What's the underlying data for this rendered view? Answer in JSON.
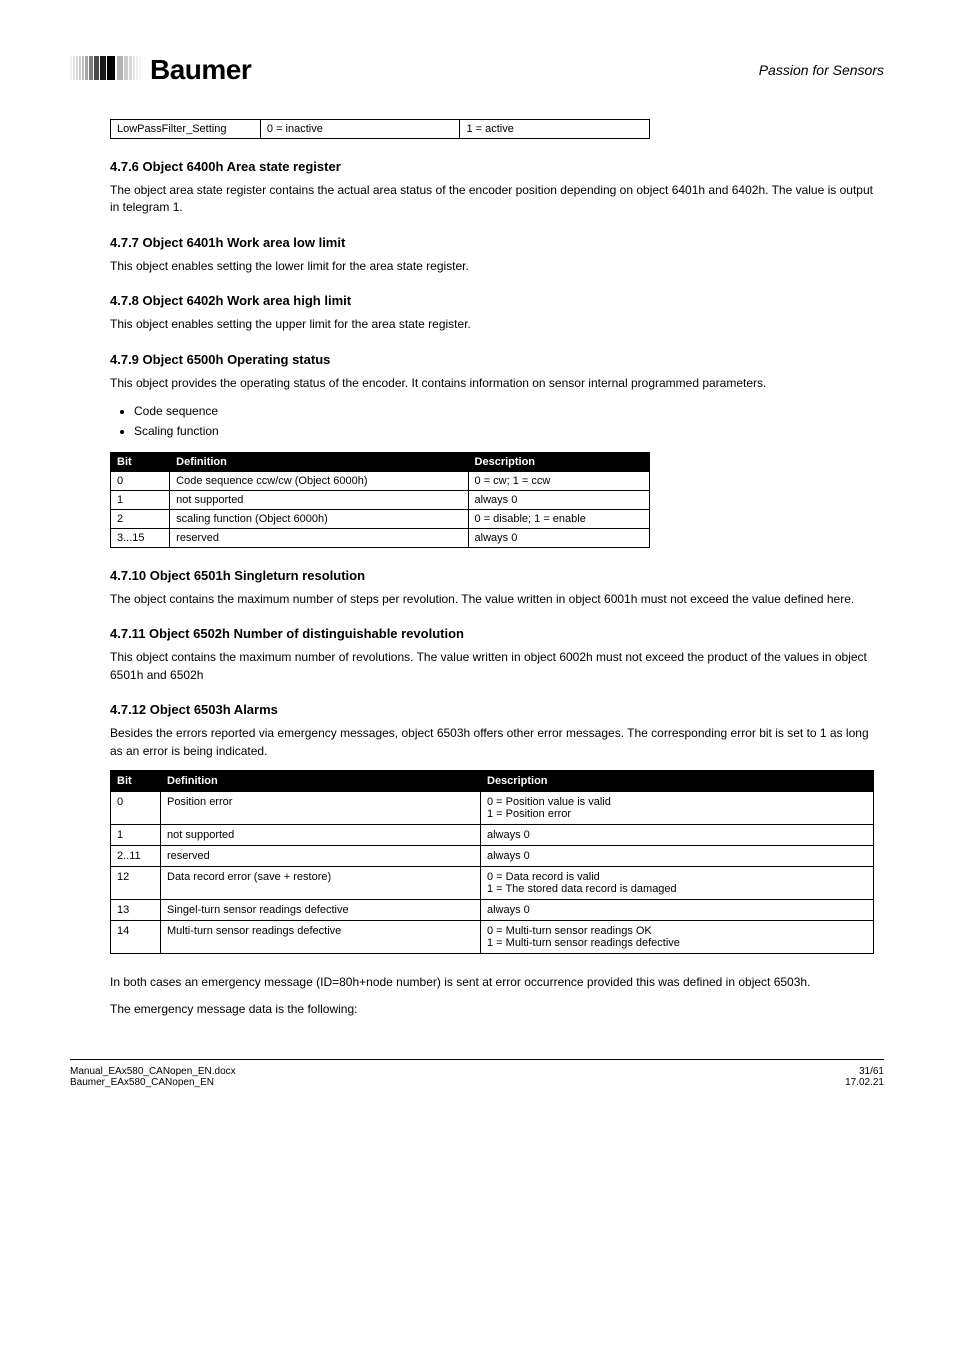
{
  "header": {
    "logo_text": "Baumer",
    "tagline": "Passion for Sensors"
  },
  "table1": {
    "rows": [
      {
        "c1": "LowPassFilter_Setting",
        "c2": "0 = inactive",
        "c3": "1 = active"
      }
    ]
  },
  "section_4_7_6": {
    "title": "4.7.6 Object 6400h Area state register",
    "text": "The object area state register contains the actual area status of the encoder position depending on object 6401h and 6402h. The value is output in telegram 1."
  },
  "section_4_7_7": {
    "title": "4.7.7 Object 6401h Work area low limit",
    "text": "This object enables setting the lower limit for the area state register."
  },
  "section_4_7_8": {
    "title": "4.7.8 Object 6402h Work area high limit",
    "text": "This object enables setting the upper limit for the area state register."
  },
  "section_4_7_9": {
    "title": "4.7.9 Object 6500h Operating status",
    "para1": "This object provides the operating status of the encoder. It contains information on sensor internal programmed parameters.",
    "table": {
      "headers": [
        "Bit",
        "Definition",
        "Description"
      ],
      "rows": [
        {
          "c1": "0",
          "c2": "Code sequence ccw/cw (Object 6000h)",
          "c3": "0 = cw; 1 = ccw"
        },
        {
          "c1": "1",
          "c2": "not supported",
          "c3": "always 0"
        },
        {
          "c1": "2",
          "c2": "scaling function (Object 6000h)",
          "c3": "0 = disable; 1 = enable"
        },
        {
          "c1": "3...15",
          "c2": "reserved",
          "c3": "always 0"
        }
      ]
    }
  },
  "section_4_7_10": {
    "title": "4.7.10 Object 6501h Singleturn resolution",
    "text": "The object contains the maximum number of steps per revolution. The value written in object 6001h must not exceed the value defined here."
  },
  "section_4_7_11": {
    "title": "4.7.11 Object 6502h Number of distinguishable revolution",
    "text": "This object contains the maximum number of revolutions. The value written in object 6002h must not exceed the product of the values in object 6501h and 6502h"
  },
  "section_4_7_12": {
    "title": "4.7.12 Object 6503h Alarms",
    "para1": "Besides the errors reported via emergency messages, object 6503h offers other error messages. The corresponding error bit is set to 1 as long as an error is being indicated.",
    "table": {
      "headers": [
        "Bit",
        "Definition",
        "Description"
      ],
      "rows": [
        {
          "c1": "0",
          "c2": "Position error",
          "c3": "0 = Position value is valid\n1 = Position error"
        },
        {
          "c1": "1",
          "c2": "not supported",
          "c3": "always 0"
        },
        {
          "c1": "2..11",
          "c2": "reserved",
          "c3": "always 0"
        },
        {
          "c1": "12",
          "c2": "Data record error (save + restore)",
          "c3": "0 = Data record is valid\n1 = The stored data record is damaged"
        },
        {
          "c1": "13",
          "c2": "Singel-turn sensor readings defective",
          "c3": "always 0"
        },
        {
          "c1": "14",
          "c2": "Multi-turn sensor readings defective",
          "c3": "0 = Multi-turn sensor readings OK\n1 = Multi-turn sensor readings defective"
        }
      ]
    },
    "para2": "In both cases an emergency message (ID=80h+node number) is sent at error occurrence provided this was defined in object 6503h.",
    "para3": "The emergency message data is the following:"
  },
  "bullet_block_6500": {
    "items": [
      "Code sequence",
      "Scaling function"
    ]
  },
  "footer": {
    "left_line1": "Manual_EAx580_CANopen_EN.docx",
    "left_line2": "Baumer_EAx580_CANopen_EN",
    "right_line1": "31/61",
    "right_line2": "17.02.21"
  }
}
